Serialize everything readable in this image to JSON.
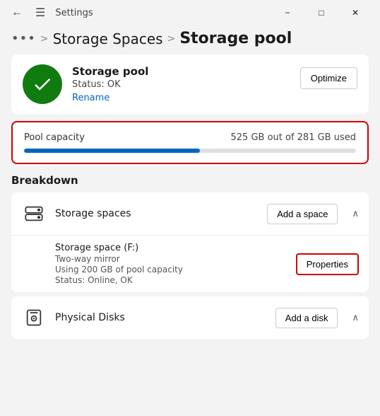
{
  "titlebar": {
    "back_icon": "←",
    "menu_icon": "☰",
    "title": "Settings",
    "minimize_label": "−",
    "maximize_label": "□",
    "close_label": "✕"
  },
  "breadcrumb": {
    "dots": "•••",
    "sep1": ">",
    "link": "Storage Spaces",
    "sep2": ">",
    "current": "Storage pool"
  },
  "pool": {
    "name": "Storage pool",
    "status": "Status: OK",
    "rename": "Rename",
    "optimize_label": "Optimize"
  },
  "capacity": {
    "label": "Pool capacity",
    "value": "525 GB out of 281 GB used",
    "percent": 53
  },
  "breakdown": {
    "title": "Breakdown"
  },
  "storage_spaces": {
    "label": "Storage spaces",
    "add_button": "Add a space",
    "sub_item": {
      "name": "Storage space (F:)",
      "line1": "Two-way mirror",
      "line2": "Using 200 GB of pool capacity",
      "line3": "Status: Online, OK",
      "properties_label": "Properties"
    }
  },
  "physical_disks": {
    "label": "Physical Disks",
    "add_button": "Add a disk"
  }
}
